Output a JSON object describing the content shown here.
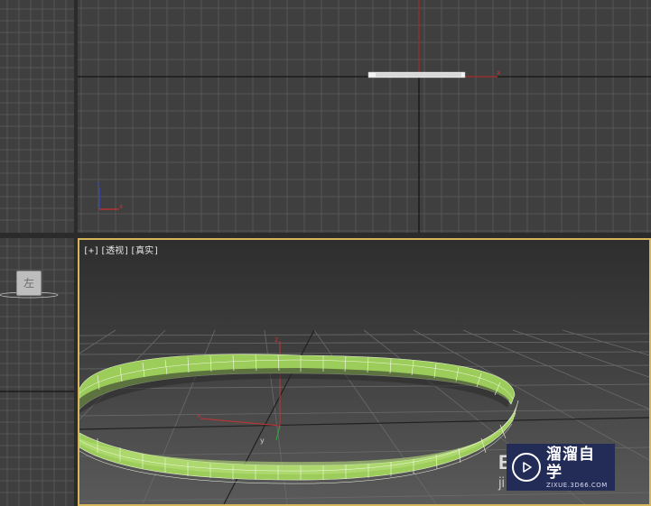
{
  "viewports": {
    "perspective": {
      "label_plus": "[+]",
      "label_view": "[透视]",
      "label_shading": "[真实]",
      "axis_x": "x",
      "axis_y": "y",
      "axis_z": "z"
    },
    "front": {
      "axis_x": "x",
      "axis_z": "z"
    },
    "left": {
      "viewcube_label": "左"
    }
  },
  "watermark": {
    "title": "溜溜自学",
    "url": "ZIXUE.3D66.COM",
    "icon": "play-icon"
  },
  "partially_hidden_text": {
    "line1": "E",
    "line2": "ji"
  },
  "colors": {
    "active_border": "#d7b55a",
    "ring_green": "#9ccc5a",
    "axis_x": "#c83232",
    "axis_y": "#33aa33",
    "axis_z": "#3344cc",
    "watermark_bg": "#232c57"
  }
}
